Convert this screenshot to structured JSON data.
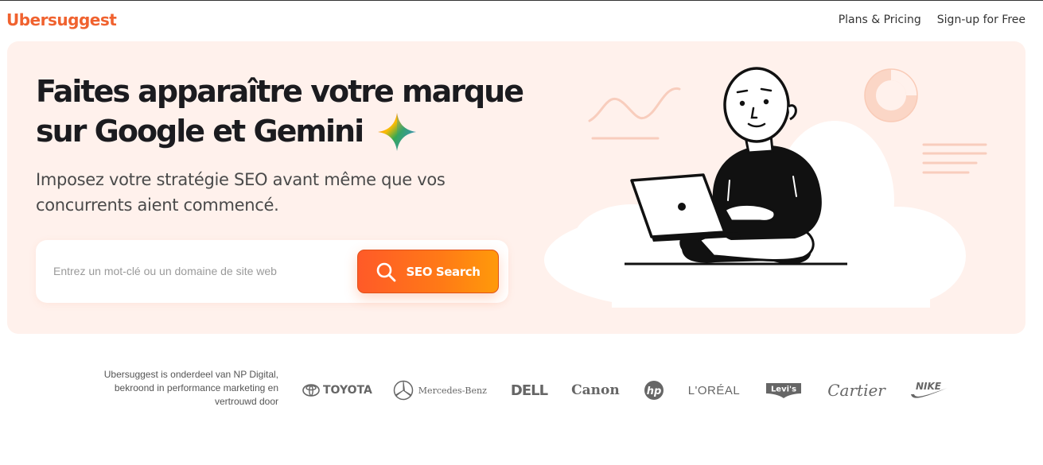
{
  "app": {
    "logo": "Ubersuggest",
    "brand_color": "#f0622f"
  },
  "nav": {
    "items": [
      {
        "label": "Plans & Pricing"
      },
      {
        "label": "Sign-up for Free"
      }
    ]
  },
  "hero": {
    "headline_line1": "Faites apparaître votre marque",
    "headline_line2": "sur Google et Gemini",
    "subtitle": "Imposez votre stratégie SEO avant même que vos concurrents aient commencé.",
    "search": {
      "placeholder": "Entrez un mot-clé ou un domaine de site web",
      "value": "",
      "button_label": "SEO Search",
      "button_icon": "search-icon"
    },
    "background_color": "#fff1ec"
  },
  "footer": {
    "trust_text_line1": "Ubersuggest is onderdeel van NP Digital,",
    "trust_text_line2": "bekroond in performance marketing en",
    "trust_text_line3": "vertrouwd door",
    "brands": {
      "toyota": "TOYOTA",
      "mercedes": "Mercedes-Benz",
      "dell": "DELL",
      "canon": "Canon",
      "hp": "hp",
      "loreal": "L'ORÉAL",
      "levis": "Levi's",
      "cartier": "Cartier",
      "nike": "NIKE"
    }
  }
}
